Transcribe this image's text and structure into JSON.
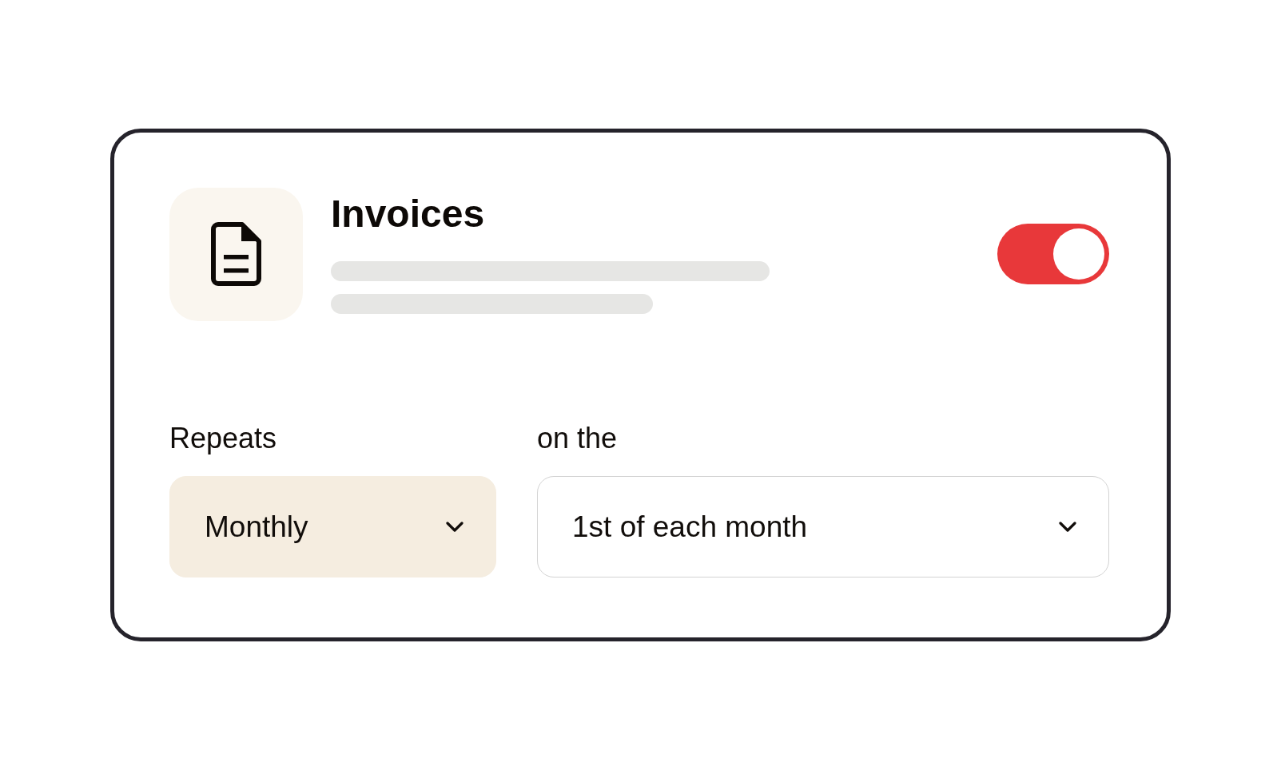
{
  "card": {
    "title": "Invoices",
    "on": true,
    "fields": [
      {
        "label": "Repeats",
        "kind": "filled",
        "value": "Monthly"
      },
      {
        "label": "on the",
        "kind": "outlined",
        "value": "1st of each month"
      }
    ]
  }
}
